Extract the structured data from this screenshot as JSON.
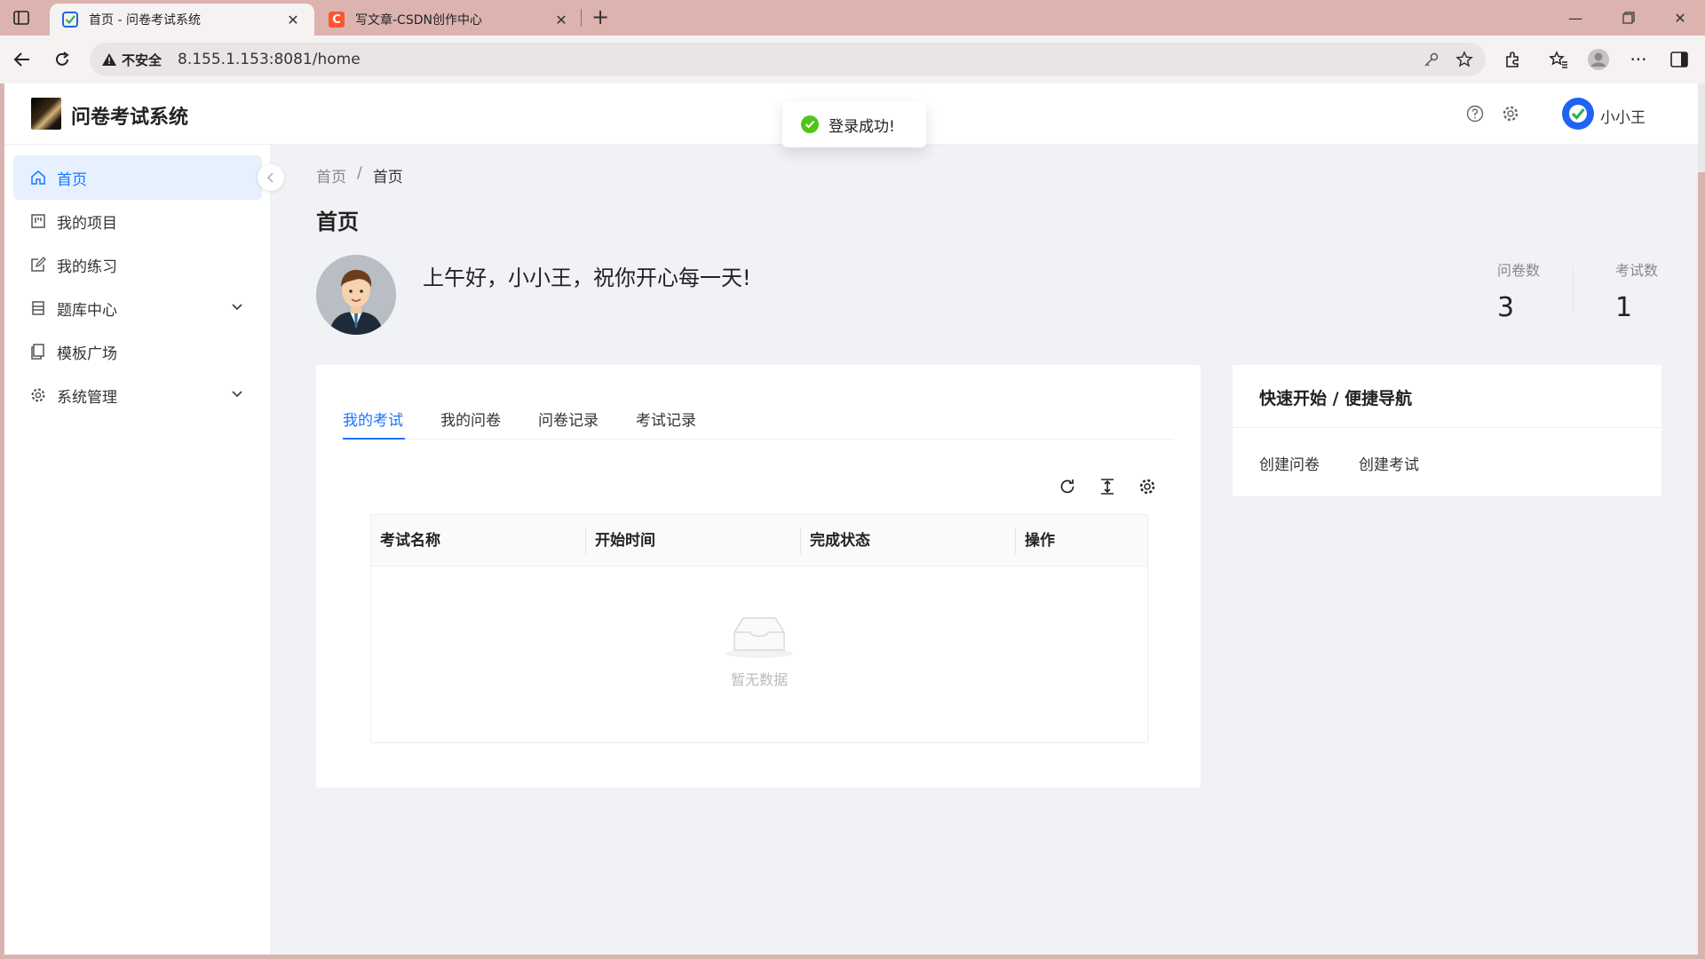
{
  "browser": {
    "tabs": [
      {
        "title": "首页 - 问卷考试系统",
        "active": true,
        "icon": "check-square-icon"
      },
      {
        "title": "写文章-CSDN创作中心",
        "active": false,
        "icon": "csdn-c-icon"
      }
    ],
    "address": {
      "security_label": "不安全",
      "url": "8.155.1.153:8081/home"
    }
  },
  "app": {
    "title": "问卷考试系统",
    "user_name": "小小王"
  },
  "toast": {
    "message": "登录成功!"
  },
  "sidebar": {
    "items": [
      {
        "label": "首页",
        "icon": "home-icon",
        "active": true
      },
      {
        "label": "我的项目",
        "icon": "project-icon"
      },
      {
        "label": "我的练习",
        "icon": "edit-icon"
      },
      {
        "label": "题库中心",
        "icon": "database-icon",
        "expandable": true
      },
      {
        "label": "模板广场",
        "icon": "template-icon"
      },
      {
        "label": "系统管理",
        "icon": "gear-icon",
        "expandable": true
      }
    ]
  },
  "main": {
    "breadcrumb": [
      "首页",
      "首页"
    ],
    "breadcrumb_sep": "/",
    "page_title": "首页",
    "greeting": "上午好，小小王，祝你开心每一天!",
    "stats": [
      {
        "label": "问卷数",
        "value": "3"
      },
      {
        "label": "考试数",
        "value": "1"
      }
    ],
    "tabs": [
      "我的考试",
      "我的问卷",
      "问卷记录",
      "考试记录"
    ],
    "table": {
      "columns": [
        "考试名称",
        "开始时间",
        "完成状态",
        "操作"
      ],
      "empty_text": "暂无数据"
    },
    "quick_nav": {
      "title": "快速开始 / 便捷导航",
      "links": [
        "创建问卷",
        "创建考试"
      ]
    }
  },
  "colors": {
    "primary": "#1677ff",
    "success": "#52c41a",
    "tabbar": "#dcb3af"
  }
}
